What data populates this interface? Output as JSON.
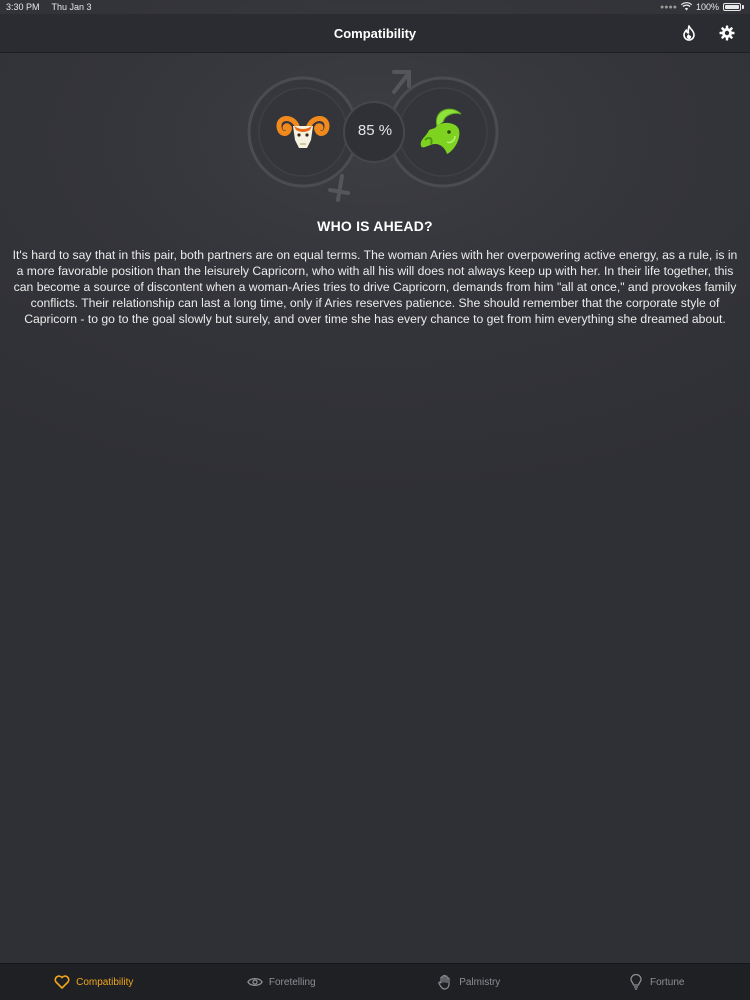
{
  "status_bar": {
    "time": "3:30 PM",
    "date": "Thu Jan 3",
    "battery": "100%"
  },
  "nav": {
    "title": "Compatibility",
    "actions": [
      {
        "name": "fire-icon"
      },
      {
        "name": "gear-icon"
      }
    ]
  },
  "pair": {
    "left_sign": {
      "name": "Aries",
      "icon": "aries-ram-icon",
      "color": "#f08a1e"
    },
    "right_sign": {
      "name": "Capricorn",
      "icon": "capricorn-goat-icon",
      "color": "#7ed321"
    },
    "percent": "85 %"
  },
  "section": {
    "heading": "WHO IS AHEAD?",
    "body": "It's hard to say that in this pair, both partners are on equal terms. The woman Aries with her overpowering active energy, as a rule, is in a more favorable position than the leisurely Capricorn, who with all his will does not always keep up with her. In their life together, this can become a source of discontent when a woman-Aries tries to drive Capricorn, demands from him \"all at once,\" and provokes family conflicts. Their relationship can last a long time, only if Aries reserves patience. She should remember that the corporate style of Capricorn - to go to the goal slowly but surely, and over time she has every chance to get from him everything she dreamed about."
  },
  "tabs": [
    {
      "label": "Compatibility",
      "icon": "heart-icon",
      "active": true
    },
    {
      "label": "Foretelling",
      "icon": "eye-icon",
      "active": false
    },
    {
      "label": "Palmistry",
      "icon": "palm-icon",
      "active": false
    },
    {
      "label": "Fortune",
      "icon": "lightbulb-icon",
      "active": false
    }
  ],
  "colors": {
    "accent": "#f0a61c",
    "background": "#2f3035",
    "tab_inactive": "#8d8e93"
  }
}
